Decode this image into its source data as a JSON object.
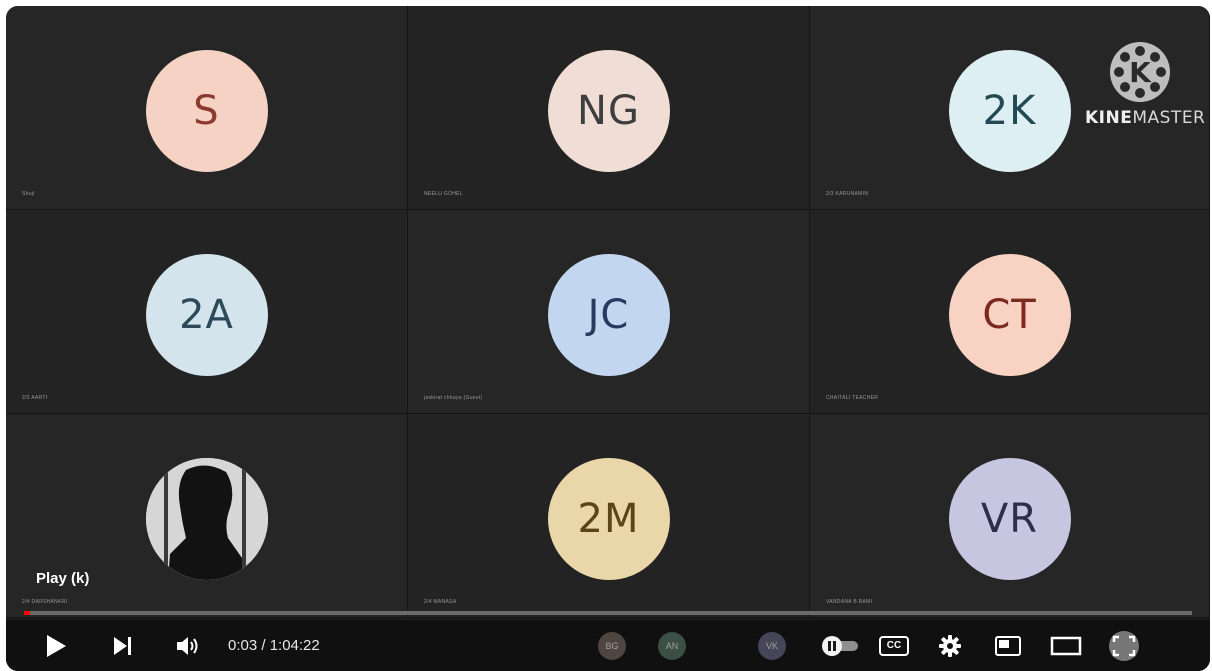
{
  "participants": [
    {
      "initials": "S",
      "name": "Shuji",
      "bg": "#f5d2c4",
      "fg": "#8a3a2e"
    },
    {
      "initials": "NG",
      "name": "NEELU GOHEL",
      "bg": "#efddd6",
      "fg": "#3e3e3e"
    },
    {
      "initials": "2K",
      "name": "2/3 KARUNAMIN",
      "bg": "#ddeff2",
      "fg": "#234a54"
    },
    {
      "initials": "2A",
      "name": "2/2 AARTI",
      "bg": "#d4e4ec",
      "fg": "#2c4a5a"
    },
    {
      "initials": "JC",
      "name": "jaskirat chhaya (Guest)",
      "bg": "#c3d6f0",
      "fg": "#253c60"
    },
    {
      "initials": "CT",
      "name": "CHAITALI TEACHER",
      "bg": "#f8d2c2",
      "fg": "#7a2a1e"
    },
    {
      "initials": "",
      "name": "2/4 DARSHANKRI",
      "bg": "#dcdcdc",
      "fg": "#000000"
    },
    {
      "initials": "2M",
      "name": "2/4 MANASA",
      "bg": "#e9d6a9",
      "fg": "#5a4418"
    },
    {
      "initials": "VR",
      "name": "VANDANA B RAMI",
      "bg": "#c6c6e0",
      "fg": "#2d2d4e"
    }
  ],
  "watermark": {
    "logo_letter": "K",
    "brand_bold": "KINE",
    "brand_rest": "MASTER"
  },
  "player": {
    "tooltip": "Play (k)",
    "time": "0:03 / 1:04:22",
    "progress": 0.0008,
    "mini_avatars": [
      "BG",
      "AN",
      "VK"
    ],
    "cc_label": "CC",
    "icons": [
      "play-icon",
      "next-icon",
      "volume-icon",
      "autoplay-toggle-icon",
      "subtitles-icon",
      "settings-icon",
      "miniplayer-icon",
      "theater-icon",
      "fullscreen-icon"
    ]
  }
}
